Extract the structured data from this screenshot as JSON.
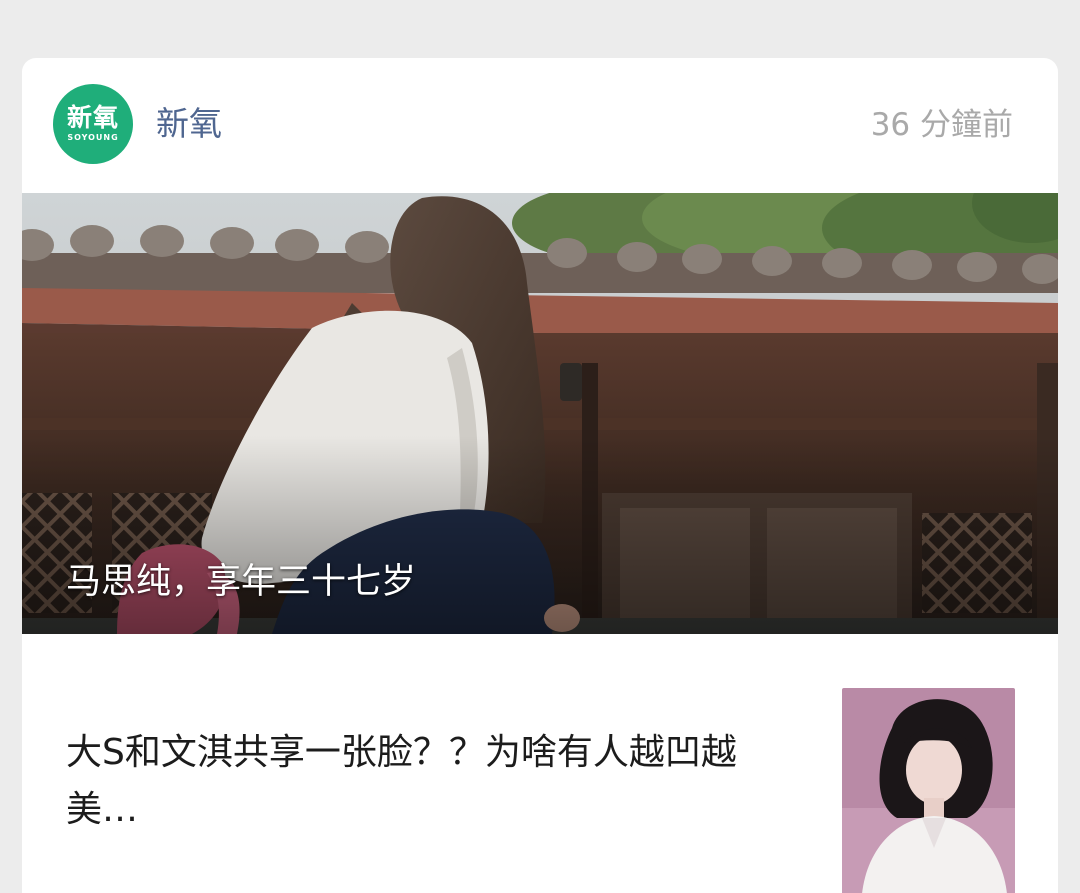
{
  "post": {
    "account": {
      "logo_text": "新氧",
      "logo_subtext": "SOYOUNG",
      "name": "新氧",
      "brand_color": "#1fae7a"
    },
    "timestamp": "36 分鐘前",
    "hero": {
      "caption": "马思纯，享年三十七岁"
    },
    "article": {
      "title": "大S和文淇共享一张脸？？为啥有人越凹越美…"
    }
  }
}
